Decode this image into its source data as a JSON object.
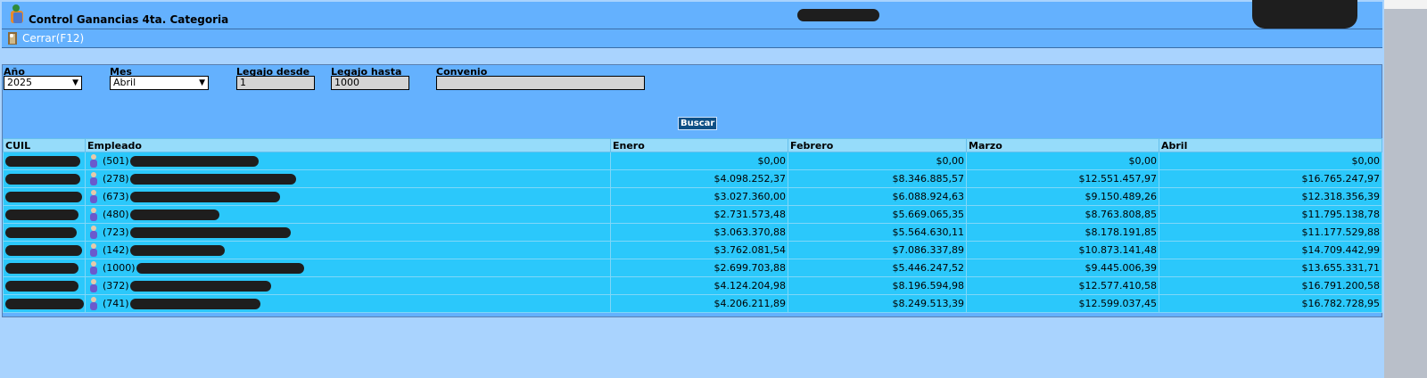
{
  "window": {
    "title": "Control Ganancias 4ta. Categoria"
  },
  "toolbar": {
    "close_label": "Cerrar(F12)"
  },
  "filters": {
    "year_label": "Año",
    "year_value": "2025",
    "month_label": "Mes",
    "month_value": "Abril",
    "legajo_from_label": "Legajo desde",
    "legajo_from_value": "1",
    "legajo_to_label": "Legajo hasta",
    "legajo_to_value": "1000",
    "convenio_label": "Convenio",
    "convenio_value": ""
  },
  "search_button": "Buscar",
  "table": {
    "columns": {
      "cuil": "CUIL",
      "employee": "Empleado",
      "m1": "Enero",
      "m2": "Febrero",
      "m3": "Marzo",
      "m4": "Abril"
    },
    "rows": [
      {
        "legajo": "(501)",
        "m1": "$0,00",
        "m2": "$0,00",
        "m3": "$0,00",
        "m4": "$0,00"
      },
      {
        "legajo": "(278)",
        "m1": "$4.098.252,37",
        "m2": "$8.346.885,57",
        "m3": "$12.551.457,97",
        "m4": "$16.765.247,97"
      },
      {
        "legajo": "(673)",
        "m1": "$3.027.360,00",
        "m2": "$6.088.924,63",
        "m3": "$9.150.489,26",
        "m4": "$12.318.356,39"
      },
      {
        "legajo": "(480)",
        "m1": "$2.731.573,48",
        "m2": "$5.669.065,35",
        "m3": "$8.763.808,85",
        "m4": "$11.795.138,78"
      },
      {
        "legajo": "(723)",
        "m1": "$3.063.370,88",
        "m2": "$5.564.630,11",
        "m3": "$8.178.191,85",
        "m4": "$11.177.529,88"
      },
      {
        "legajo": "(142)",
        "m1": "$3.762.081,54",
        "m2": "$7.086.337,89",
        "m3": "$10.873.141,48",
        "m4": "$14.709.442,99"
      },
      {
        "legajo": "(1000)",
        "m1": "$2.699.703,88",
        "m2": "$5.446.247,52",
        "m3": "$9.445.006,39",
        "m4": "$13.655.331,71"
      },
      {
        "legajo": "(372)",
        "m1": "$4.124.204,98",
        "m2": "$8.196.594,98",
        "m3": "$12.577.410,58",
        "m4": "$16.791.200,58"
      },
      {
        "legajo": "(741)",
        "m1": "$4.206.211,89",
        "m2": "$8.249.513,39",
        "m3": "$12.599.037,45",
        "m4": "$16.782.728,95"
      }
    ]
  },
  "icons": {
    "app": "app-icon",
    "close": "exit-icon",
    "person": "person-icon"
  }
}
